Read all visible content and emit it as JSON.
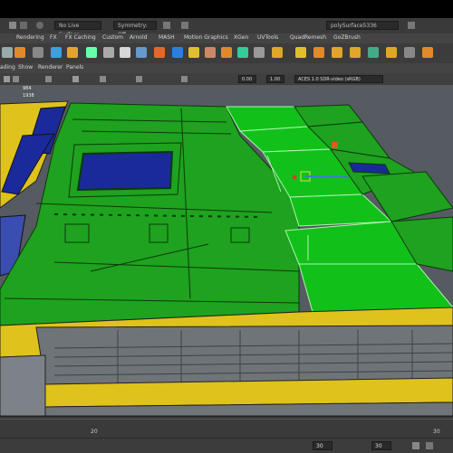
{
  "topbar": {
    "live_surface": "No Live Surface",
    "symmetry": "Symmetry: Off",
    "object_name": "polySurface5336"
  },
  "menu_tabs": [
    "Rendering",
    "FX",
    "FX Caching",
    "Custom",
    "Arnold",
    "MASH",
    "Motion Graphics",
    "XGen",
    "UVTools",
    "QuadRemesh",
    "GoZBrush"
  ],
  "panel_menu": [
    "ading",
    "Show",
    "Renderer",
    "Panels"
  ],
  "viewport_toolbar": {
    "value_a": "0.00",
    "value_b": "1.00",
    "color_space": "ACES 1.0 SDR-video (sRGB)"
  },
  "hud": {
    "row1_value": "984",
    "row2_value": "1938"
  },
  "timeline": {
    "ticks": [
      "20",
      "30"
    ]
  },
  "range": {
    "start": "30",
    "end": "30"
  },
  "colors": {
    "selected": "#11c11a",
    "unselected_fill": "#1ea21f",
    "trim": "#dfc21b",
    "blue": "#1a2a9a"
  }
}
